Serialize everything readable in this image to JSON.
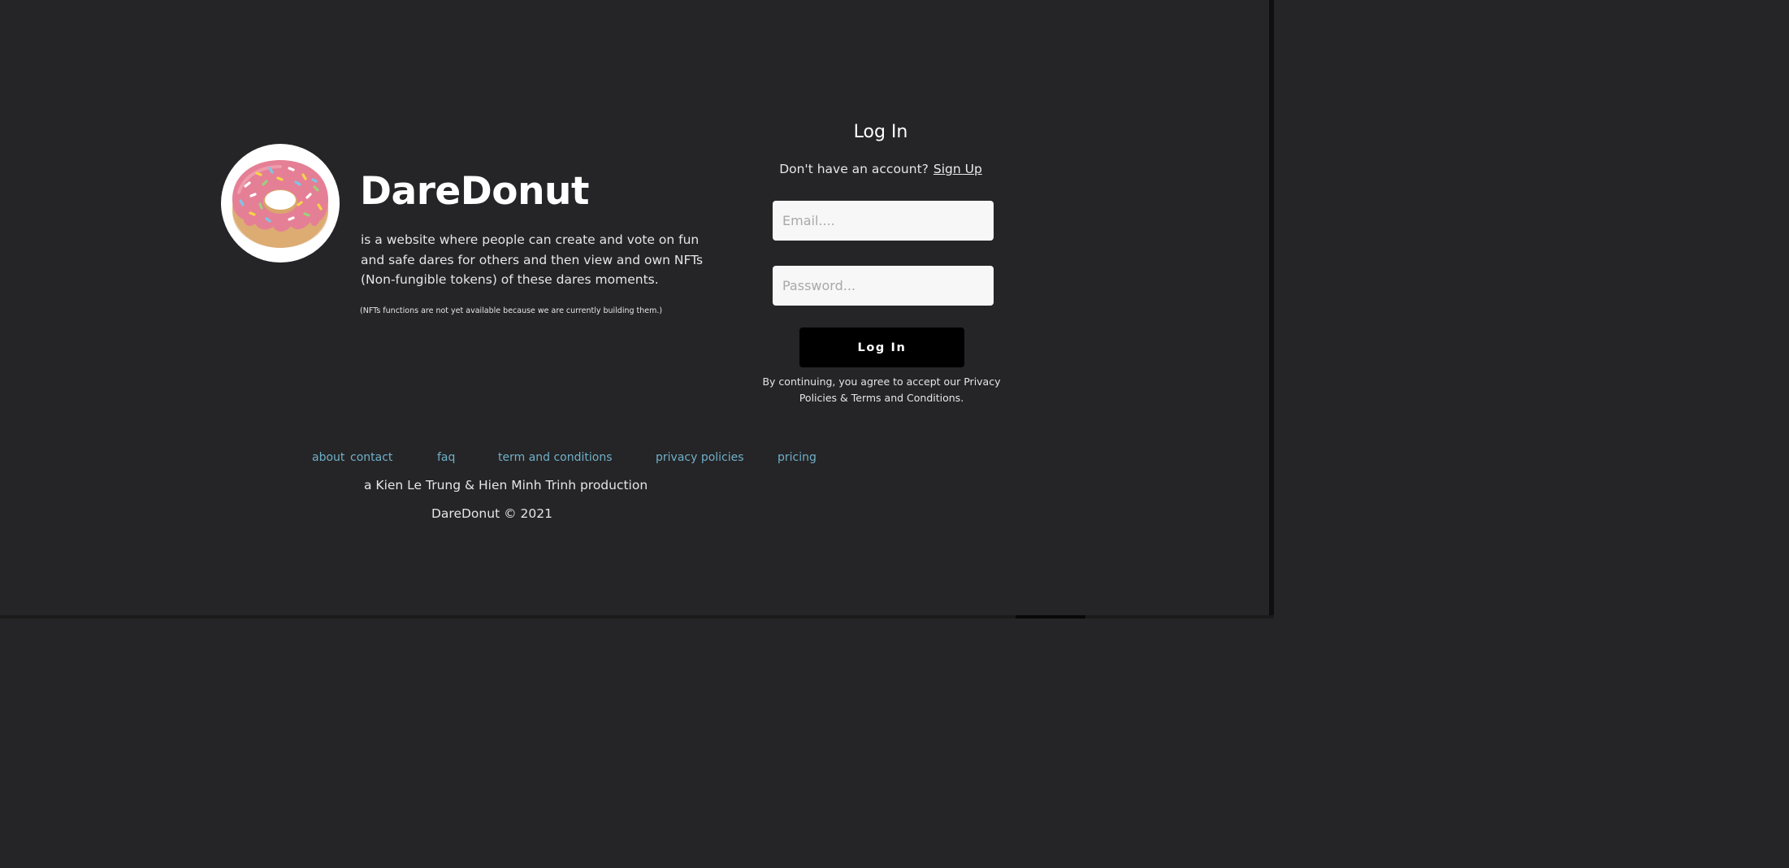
{
  "brand": {
    "name": "DareDonut",
    "description": "is a website where people can create and vote on fun and safe dares for others and then view and own NFTs (Non-fungible tokens) of these dares moments.",
    "note": "(NFTs functions are not yet available because we are currently building them.)",
    "logo_icon": "donut-icon"
  },
  "login": {
    "heading": "Log In",
    "no_account_text": "Don't have an account?",
    "signup_label": "Sign Up",
    "email": {
      "placeholder": "Email....",
      "value": ""
    },
    "password": {
      "placeholder": "Password...",
      "value": ""
    },
    "button_label": "Log In",
    "consent": "By continuing, you agree to accept our Privacy Policies & Terms and Conditions."
  },
  "footer": {
    "links": [
      "about",
      "contact",
      "faq",
      "term and conditions",
      "privacy policies",
      "pricing"
    ],
    "credit": "a Kien Le Trung & Hien Minh Trinh production",
    "copyright": "DareDonut ©  2021"
  },
  "colors": {
    "background": "#252426",
    "link": "#6fb0c7",
    "button": "#000000",
    "field": "#f7f7f7",
    "icing": "#e57f95",
    "dough": "#e0b47f"
  }
}
